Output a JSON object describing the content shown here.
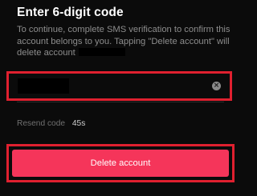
{
  "header": {
    "title": "Enter 6-digit code"
  },
  "description": {
    "text": "To continue, complete SMS verification to confirm this account belongs to you. Tapping \"Delete account\" will delete account"
  },
  "code_input": {
    "clear_icon": "clear-circle-icon",
    "clear_glyph": "×"
  },
  "resend": {
    "label": "Resend code",
    "timer": "45s"
  },
  "actions": {
    "delete_label": "Delete account"
  },
  "colors": {
    "background": "#0b0b0b",
    "highlight_border": "#e0202f",
    "delete_button": "#f5355a",
    "muted_text": "#8d8d8d"
  }
}
